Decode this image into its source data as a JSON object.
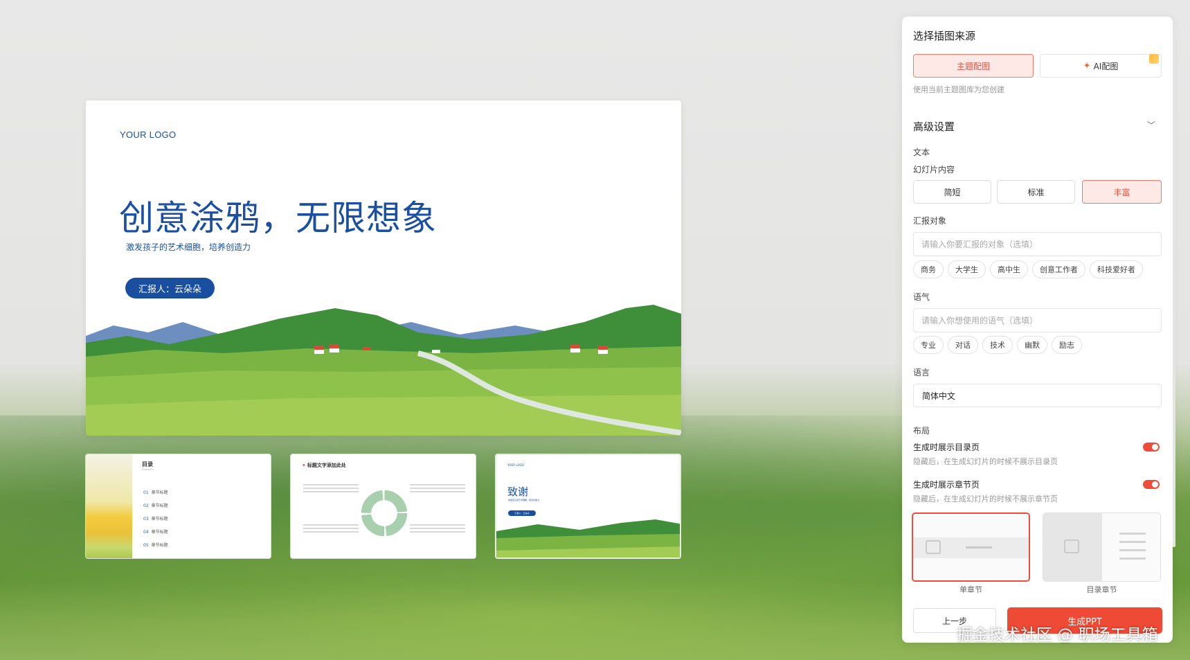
{
  "slide": {
    "logo": "YOUR LOGO",
    "title": "创意涂鸦，无限想象",
    "subtitle": "激发孩子的艺术细胞，培养创造力",
    "reporter": "汇报人：云朵朵"
  },
  "thumb1": {
    "title": "目录",
    "subtitle": "CONTENTS",
    "items": [
      {
        "num": "01",
        "label": "章节标题"
      },
      {
        "num": "02",
        "label": "章节标题"
      },
      {
        "num": "03",
        "label": "章节标题"
      },
      {
        "num": "04",
        "label": "章节标题"
      },
      {
        "num": "05",
        "label": "章节标题"
      }
    ]
  },
  "thumb2": {
    "title": "标题文字添加此处"
  },
  "thumb3": {
    "logo": "YOUR LOGO",
    "title": "致谢",
    "subtitle": "激发孩子的艺术细胞，培养创造力",
    "reporter": "汇报人：云朵朵"
  },
  "panel": {
    "source_title": "选择插图来源",
    "source_theme": "主题配图",
    "source_ai": "AI配图",
    "source_hint": "使用当前主题图库为您创建",
    "advanced_title": "高级设置",
    "text_label": "文本",
    "content_label": "幻灯片内容",
    "content_options": [
      "简短",
      "标准",
      "丰富"
    ],
    "audience_label": "汇报对象",
    "audience_placeholder": "请输入你要汇报的对象（选填）",
    "audience_chips": [
      "商务",
      "大学生",
      "高中生",
      "创意工作者",
      "科技爱好者"
    ],
    "tone_label": "语气",
    "tone_placeholder": "请输入你想使用的语气（选填）",
    "tone_chips": [
      "专业",
      "对话",
      "技术",
      "幽默",
      "励志"
    ],
    "lang_label": "语言",
    "lang_value": "简体中文",
    "layout_label": "布局",
    "toc_toggle": "生成时展示目录页",
    "toc_hint": "隐藏后，在生成幻灯片的时候不展示目录页",
    "chapter_toggle": "生成时展示章节页",
    "chapter_hint": "隐藏后，在生成幻灯片的时候不展示章节页",
    "layout_single": "单章节",
    "layout_toc": "目录章节",
    "prev": "上一步",
    "generate": "生成PPT"
  },
  "watermark": "掘金技术社区 @ 职场工具箱",
  "colors": {
    "accent": "#ee4d3a",
    "brand_blue": "#1b4fa3"
  }
}
